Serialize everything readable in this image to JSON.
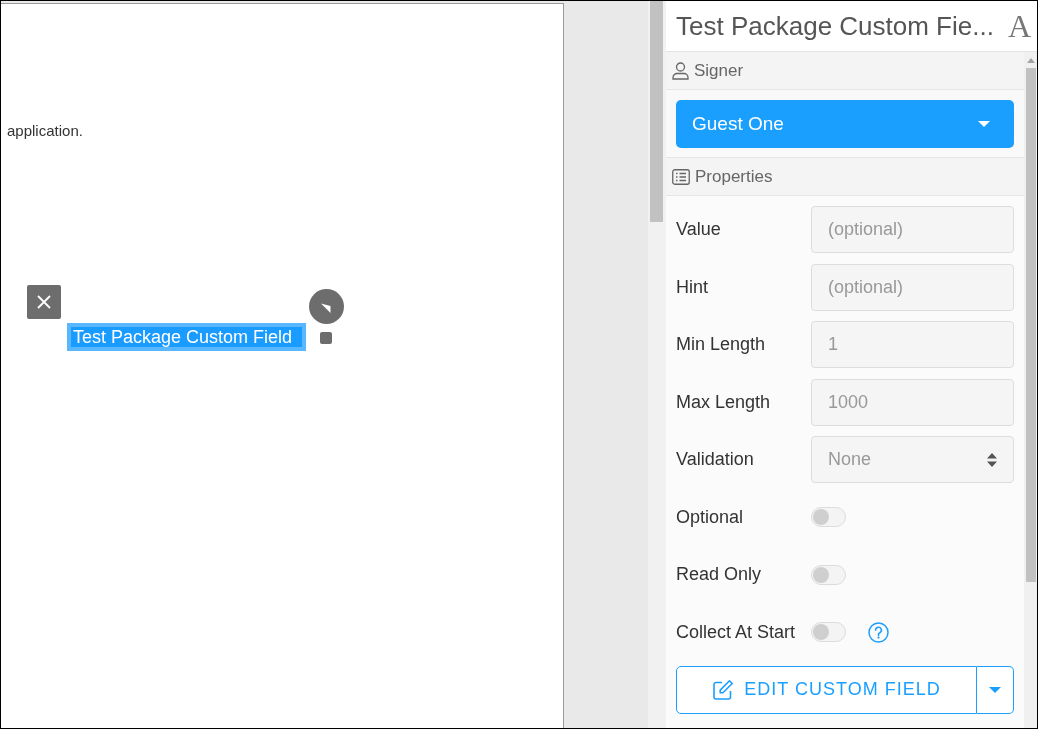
{
  "document": {
    "text_fragment": "application.",
    "field": {
      "label": "Test Package Custom Field",
      "selected": true
    }
  },
  "panel": {
    "title": "Test Package Custom Fie...",
    "type_icon": "A",
    "signer": {
      "heading": "Signer",
      "value": "Guest One"
    },
    "properties": {
      "heading": "Properties",
      "rows": [
        {
          "kind": "text",
          "label": "Value",
          "placeholder": "(optional)"
        },
        {
          "kind": "text",
          "label": "Hint",
          "placeholder": "(optional)"
        },
        {
          "kind": "text",
          "label": "Min Length",
          "value": "1"
        },
        {
          "kind": "text",
          "label": "Max Length",
          "value": "1000"
        },
        {
          "kind": "select",
          "label": "Validation",
          "value": "None"
        },
        {
          "kind": "toggle",
          "label": "Optional",
          "on": false
        },
        {
          "kind": "toggle",
          "label": "Read Only",
          "on": false
        },
        {
          "kind": "toggle",
          "label": "Collect At Start",
          "on": false,
          "help": true
        }
      ]
    },
    "action_button": {
      "label": "EDIT CUSTOM FIELD"
    }
  }
}
